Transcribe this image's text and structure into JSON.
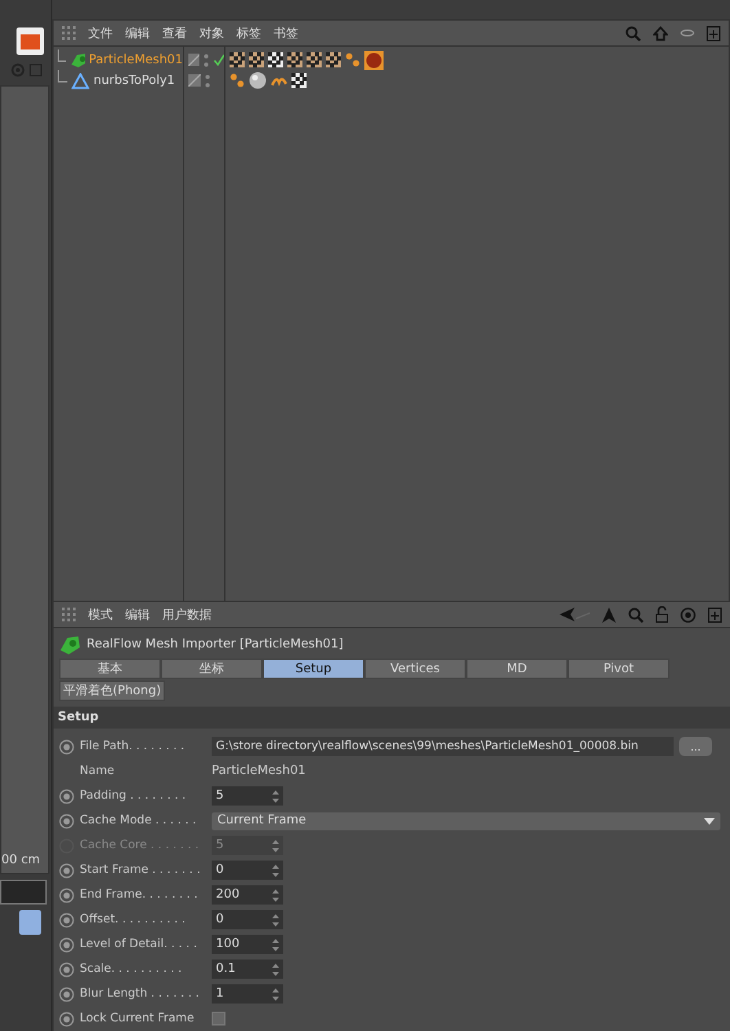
{
  "left_strip": {
    "unit_text": "00 cm"
  },
  "object_manager": {
    "menu": [
      "文件",
      "编辑",
      "查看",
      "对象",
      "标签",
      "书签"
    ],
    "objects": [
      {
        "name": "ParticleMesh01",
        "selected": true,
        "checked": true,
        "kind": "mesh"
      },
      {
        "name": "nurbsToPoly1",
        "selected": false,
        "checked": false,
        "kind": "poly"
      }
    ]
  },
  "attribute_manager": {
    "menu": [
      "模式",
      "编辑",
      "用户数据"
    ],
    "title": "RealFlow Mesh Importer [ParticleMesh01]",
    "tabs": [
      {
        "label": "基本",
        "selected": false
      },
      {
        "label": "坐标",
        "selected": false
      },
      {
        "label": "Setup",
        "selected": true
      },
      {
        "label": "Vertices",
        "selected": false
      },
      {
        "label": "MD",
        "selected": false
      },
      {
        "label": "Pivot",
        "selected": false
      }
    ],
    "second_tabs": [
      {
        "label": "平滑着色(Phong)",
        "selected": false
      }
    ],
    "section": "Setup",
    "fields": [
      {
        "kind": "path",
        "label": "File Path. . . . . . . .",
        "value": "G:\\store directory\\realflow\\scenes\\99\\meshes\\ParticleMesh01_00008.bin",
        "button": "...",
        "disabled": false
      },
      {
        "kind": "text",
        "label": "Name",
        "value": "ParticleMesh01",
        "disabled": false
      },
      {
        "kind": "spin",
        "label": "Padding . . . . . . . .",
        "value": "5",
        "disabled": false
      },
      {
        "kind": "dropdown",
        "label": "Cache Mode . . . . . .",
        "value": "Current Frame",
        "disabled": false
      },
      {
        "kind": "spin",
        "label": "Cache Core . . . . . . .",
        "value": "5",
        "disabled": true
      },
      {
        "kind": "spin",
        "label": "Start Frame . . . . . . .",
        "value": "0",
        "disabled": false
      },
      {
        "kind": "spin",
        "label": "End Frame. . . . . . . .",
        "value": "200",
        "disabled": false
      },
      {
        "kind": "spin",
        "label": "Offset. . . . . . . . . .",
        "value": "0",
        "disabled": false
      },
      {
        "kind": "spin",
        "label": "Level of Detail. . . . .",
        "value": "100",
        "disabled": false
      },
      {
        "kind": "spin",
        "label": "Scale. . . . . . . . . .",
        "value": "0.1",
        "disabled": false
      },
      {
        "kind": "spin",
        "label": "Blur Length . . . . . . .",
        "value": "1",
        "disabled": false
      },
      {
        "kind": "check",
        "label": "Lock Current Frame",
        "checked": false,
        "disabled": false
      }
    ]
  }
}
